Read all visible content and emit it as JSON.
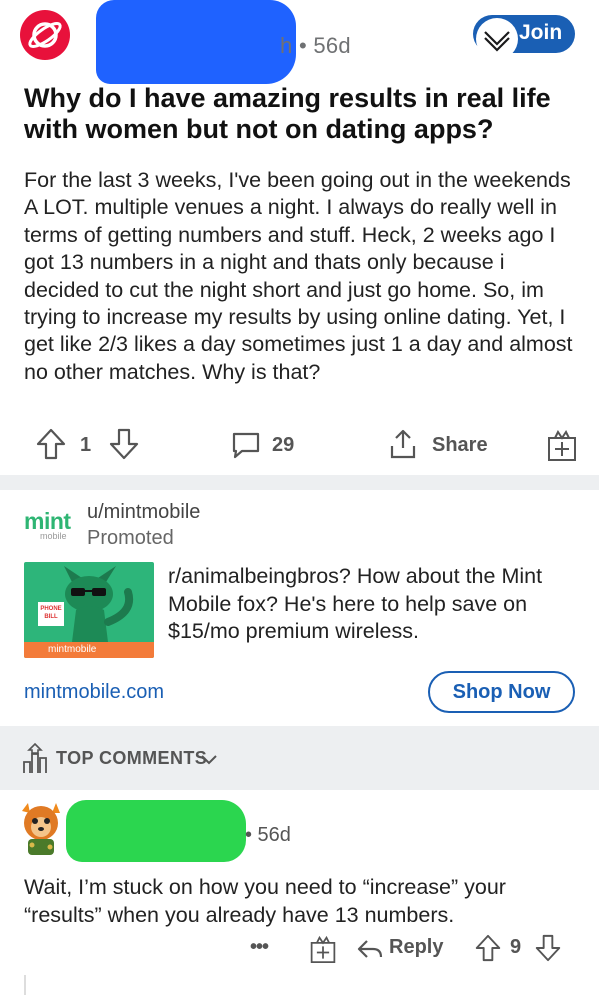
{
  "post": {
    "meta_time": "h • 56d",
    "join_label": "Join",
    "title": "Why do I have amazing results in real life with women but not on dating apps?",
    "body": "For the last 3 weeks, I've been going out in the weekends A LOT.  multiple venues a night.  I always do really well in terms of getting numbers and stuff.  Heck, 2 weeks ago I got 13 numbers in a night and thats only because i decided to cut the night short and just go home.  So, im trying to increase my results by using online dating.  Yet, I get like 2/3 likes a day sometimes just 1 a day and almost no other matches.  Why is that?",
    "votes": "1",
    "comments": "29",
    "share_label": "Share"
  },
  "ad": {
    "logo_text": "mint",
    "logo_sub": "mobile",
    "username": "u/mintmobile",
    "promoted_label": "Promoted",
    "image_sign": "PHONE BILL",
    "image_brand": "mintmobile",
    "text": "r/animalbeingbros? How about the Mint Mobile fox? He's here to help save on $15/mo premium wireless.",
    "link": "mintmobile.com",
    "cta_label": "Shop Now"
  },
  "top_comments": {
    "label": "TOP COMMENTS"
  },
  "comment": {
    "meta_time": "• 56d",
    "body": "Wait, I’m stuck on how you need to “increase” your “results” when you already have 13 numbers.",
    "more_label": "•••",
    "reply_label": "Reply",
    "votes": "9"
  },
  "colors": {
    "reddit_red": "#e8113b",
    "join_blue": "#1a5fb4",
    "mint_green": "#2eb573",
    "section_gray": "#edeff1"
  },
  "icons": [
    "reddit-planet-icon",
    "chevron-down-icon",
    "upvote-icon",
    "downvote-icon",
    "comment-bubble-icon",
    "share-icon",
    "award-gift-icon",
    "reply-arrow-icon",
    "top-comments-sort-icon",
    "more-dots-icon"
  ]
}
